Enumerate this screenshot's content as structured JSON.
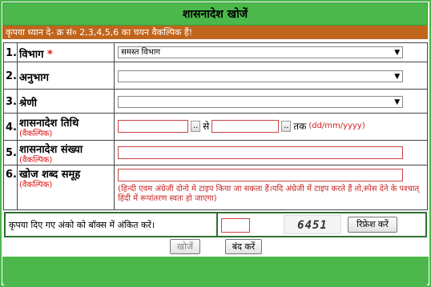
{
  "header": {
    "title": "शासनादेश खोजें"
  },
  "notice": "कृपया ध्यान दे- क्र सं० 2,3,4,5,6 का चयन वैकल्पिक हैं!",
  "rows": [
    {
      "num": "1.",
      "label": "विभाग",
      "required": "*",
      "value": "समस्त विभाग"
    },
    {
      "num": "2.",
      "label": "अनुभाग"
    },
    {
      "num": "3.",
      "label": "श्रेणी"
    },
    {
      "num": "4.",
      "label": "शासनादेश तिथि",
      "optional": "(वैकल्पिक)",
      "date_sep": "से",
      "date_to": "तक",
      "date_format": "(dd/mm/yyyy)"
    },
    {
      "num": "5.",
      "label": "शासनादेश संख्या",
      "optional": "(वैकल्पिक)"
    },
    {
      "num": "6.",
      "label": "खोज शब्द समूह",
      "optional": "(वैकल्पिक)",
      "hint": "(हिन्दी एवम अंग्रेजी दोनो मे टाइप किया जा सकता हैं।यदि अंग्रेजी में टाइप करते हैं तो,स्पेस देने के पश्चात् हिंदी में रूपांतरण स्वतः हो जाएगा)"
    }
  ],
  "captcha": {
    "label": "कृपया दिए गए अंको को बॉक्स में अंकित करें।",
    "code": "6451",
    "refresh_label": "रिफ्रेश करें"
  },
  "actions": {
    "search_label": "खोजें",
    "close_label": "बंद करें"
  },
  "calendar_btn": ".."
}
